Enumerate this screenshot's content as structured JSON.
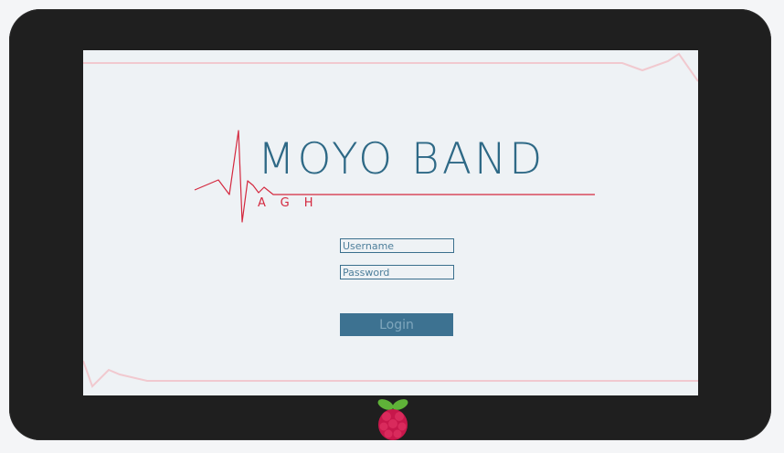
{
  "app": {
    "title": "MOYO BAND",
    "subtitle": "AGH"
  },
  "login_form": {
    "username": {
      "value": "",
      "placeholder": "Username"
    },
    "password": {
      "value": "",
      "placeholder": "Password"
    },
    "submit_label": "Login"
  },
  "device": {
    "bezel_logo_icon": "raspberry-pi-icon"
  },
  "colors": {
    "bezel": "#1f1f1f",
    "screen_background": "#eef2f5",
    "brand_blue": "#2e6986",
    "heartbeat_red": "#d4293f",
    "button": "#3d7291",
    "button_text": "#7fa7bd"
  }
}
